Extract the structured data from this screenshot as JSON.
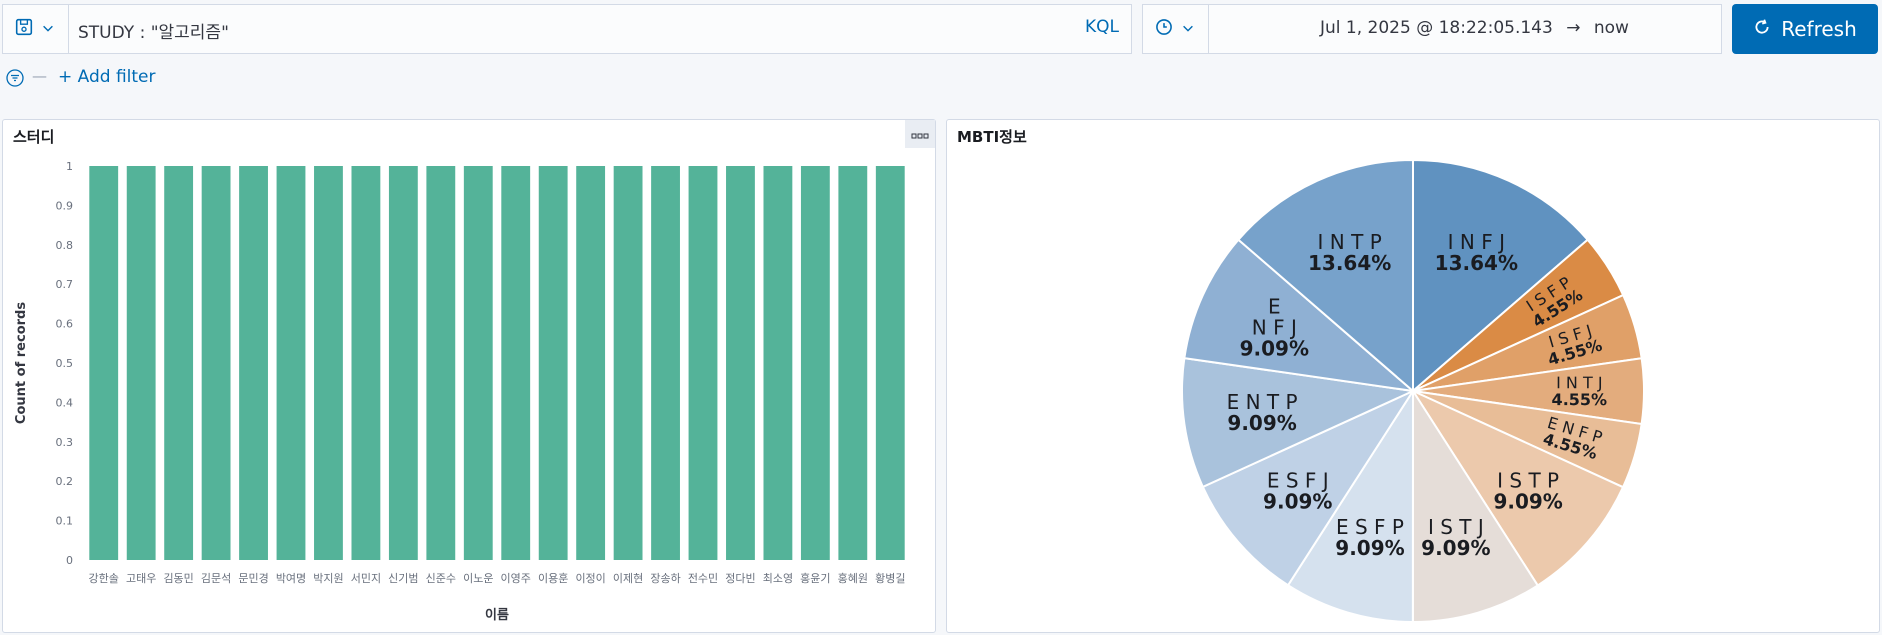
{
  "query_bar": {
    "query": "STUDY : \"알고리즘\"",
    "language": "KQL",
    "save_icon": "save-icon",
    "chevron_icon": "chevron-down-icon"
  },
  "time_picker": {
    "clock_icon": "clock-icon",
    "start": "Jul 1, 2025 @ 18:22:05.143",
    "arrow": "→",
    "end": "now"
  },
  "refresh": {
    "label": "Refresh",
    "icon": "refresh-icon"
  },
  "filters": {
    "add_label": "+ Add filter",
    "menu_icon": "filter-menu-icon",
    "separator": "—"
  },
  "panels": {
    "bar": {
      "title": "스터디"
    },
    "pie": {
      "title": "MBTI정보"
    }
  },
  "colors": {
    "accent": "#006bb4",
    "bar": "#54b399",
    "pie_blue": [
      "#6092c0",
      "#6f9cc6",
      "#7ea6cd",
      "#98b7d6",
      "#a9c2dc",
      "#bfd1e6",
      "#d5e1ee"
    ],
    "pie_orange": [
      "#da8b45",
      "#e0a068",
      "#e3ac7d",
      "#e8bd97",
      "#ecc9ac",
      "#e5d9d1"
    ]
  },
  "chart_data": [
    {
      "type": "bar",
      "title": "스터디",
      "xlabel": "이름",
      "ylabel": "Count of records",
      "ylim": [
        0,
        1
      ],
      "yticks": [
        "0",
        "0.1",
        "0.2",
        "0.3",
        "0.4",
        "0.5",
        "0.6",
        "0.7",
        "0.8",
        "0.9",
        "1"
      ],
      "categories": [
        "강한솔",
        "고태우",
        "김동민",
        "김문석",
        "문민경",
        "박여명",
        "박지원",
        "서민지",
        "신기범",
        "신준수",
        "이노운",
        "이영주",
        "이용훈",
        "이정이",
        "이제현",
        "장송하",
        "전수민",
        "정다빈",
        "최소영",
        "홍윤기",
        "홍혜원",
        "황병길"
      ],
      "values": [
        1,
        1,
        1,
        1,
        1,
        1,
        1,
        1,
        1,
        1,
        1,
        1,
        1,
        1,
        1,
        1,
        1,
        1,
        1,
        1,
        1,
        1
      ],
      "grid": false
    },
    {
      "type": "pie",
      "title": "MBTI정보",
      "slices": [
        {
          "label": "I N F J",
          "pct": "13.64%",
          "value": 13.64,
          "color": "#6092c0"
        },
        {
          "label": "I S F P",
          "pct": "4.55%",
          "value": 4.55,
          "color": "#da8b45"
        },
        {
          "label": "I S F J",
          "pct": "4.55%",
          "value": 4.55,
          "color": "#e0a068"
        },
        {
          "label": "I N T J",
          "pct": "4.55%",
          "value": 4.55,
          "color": "#e3ac7d"
        },
        {
          "label": "E N F P",
          "pct": "4.55%",
          "value": 4.55,
          "color": "#e8bd97"
        },
        {
          "label": "I S T P",
          "pct": "9.09%",
          "value": 9.09,
          "color": "#ecc9ac"
        },
        {
          "label": "I S T J",
          "pct": "9.09%",
          "value": 9.09,
          "color": "#e5ddd8"
        },
        {
          "label": "E S F P",
          "pct": "9.09%",
          "value": 9.09,
          "color": "#d5e1ee"
        },
        {
          "label": "E S F J",
          "pct": "9.09%",
          "value": 9.09,
          "color": "#bfd1e6"
        },
        {
          "label": "E N T P",
          "pct": "9.09%",
          "value": 9.09,
          "color": "#a9c2dc"
        },
        {
          "label": "E\nN F J",
          "pct": "9.09%",
          "value": 9.09,
          "color": "#8fb0d3"
        },
        {
          "label": "I N T P",
          "pct": "13.64%",
          "value": 13.64,
          "color": "#77a2cb"
        }
      ]
    }
  ]
}
